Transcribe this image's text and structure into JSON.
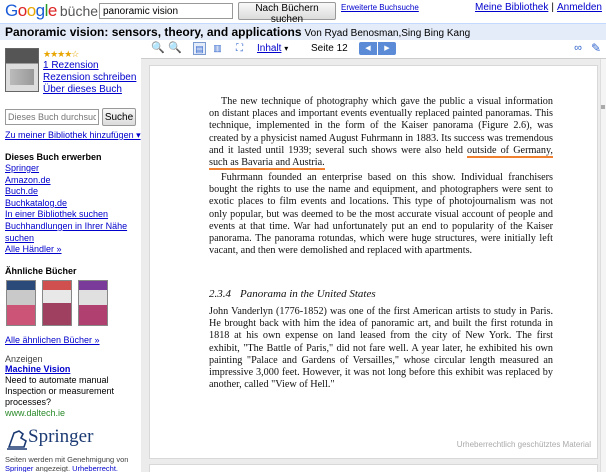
{
  "header": {
    "logo_word": "Google",
    "logo_sub": "bücher",
    "search_value": "panoramic vision",
    "search_button": "Nach Büchern suchen",
    "advanced_search": "Erweiterte Buchsuche",
    "my_library": "Meine Bibliothek",
    "sign_in": "Anmelden",
    "separator": "|"
  },
  "book": {
    "title": "Panoramic vision: sensors, theory, and applications",
    "authors": "Von Ryad Benosman,Sing Bing Kang",
    "stars": "★★★★☆",
    "review_count": "1 Rezension",
    "write_review": "Rezension schreiben",
    "about": "Über dieses Buch"
  },
  "sidebar": {
    "inbook_placeholder": "Dieses Buch durchsuchen",
    "inbook_button": "Suche",
    "add_to_library": "Zu meiner Bibliothek hinzufügen ▾",
    "buy_heading": "Dieses Buch erwerben",
    "buy_links": [
      "Springer",
      "Amazon.de",
      "Buch.de",
      "Buchkatalog.de",
      "In einer Bibliothek suchen",
      "Buchhandlungen in Ihrer Nähe suchen",
      "Alle Händler »"
    ],
    "similar_heading": "Ähnliche Bücher",
    "more_similar": "Alle ähnlichen Bücher »",
    "ads_label": "Anzeigen",
    "ad_title": "Machine Vision",
    "ad_text": "Need to automate manual Inspection or measurement processes?",
    "ad_url": "www.daltech.ie",
    "publisher_name": "Springer",
    "publisher_note_1": "Seiten werden mit Genehmigung von ",
    "publisher_note_link": "Springer",
    "publisher_note_2": " angezeigt. ",
    "publisher_note_copyright": "Urheberrecht."
  },
  "toolbar": {
    "contents": "Inhalt",
    "contents_arrow": "▾",
    "page_label": "Seite 12",
    "prev": "◀",
    "next": "▶"
  },
  "page": {
    "para1_start": "The new technique of photography which gave the public a visual information on distant places and important events eventually replaced painted panoramas. This technique, implemented in the form of the Kaiser panorama (Figure 2.6), was created by a physicist named August Fuhrmann in 1883. Its success was tremendous and it lasted until 1939; several such shows were also held ",
    "para1_highlight": "outside of Germany, such as Bavaria and Austria.",
    "para2": "Fuhrmann founded an enterprise based on this show. Individual franchisers bought the rights to use the name and equipment, and photographers were sent to exotic places to film events and locations. This type of photojournalism was not only popular, but was deemed to be the most accurate visual account of people and events at that time. War had unfortunately put an end to popularity of the Kaiser panorama. The panorama rotundas, which were huge structures, were initially left vacant, and then were demolished and replaced with apartments.",
    "section_number": "2.3.4",
    "section_title": "Panorama in the United States",
    "para3": "John Vanderlyn (1776-1852) was one of the first American artists to study in Paris. He brought back with him the idea of panoramic art, and built the first rotunda in 1818 at his own expense on land leased from the city of New York. The first exhibit, \"The Battle of Paris,\" did not fare well. A year later, he exhibited his own painting \"Palace and Gardens of Versailles,\" whose circular length measured an impressive 3,000 feet. However, it was not long before this exhibit was replaced by another, called \"View of Hell.\"",
    "watermark": "Urheberrechtlich geschütztes Material"
  },
  "icons": {
    "zoom_out": "🔍",
    "zoom_in": "🔍",
    "single_page": "▤",
    "two_page": "▥",
    "fullscreen": "⛶",
    "link": "∞",
    "feedback": "✎"
  }
}
